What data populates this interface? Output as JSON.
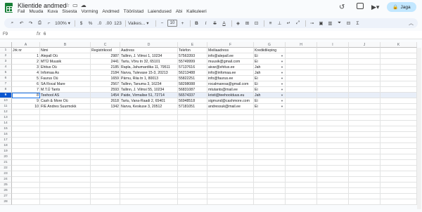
{
  "app": {
    "title": "Klientide andmed",
    "menu": [
      "Fail",
      "Muuda",
      "Kuva",
      "Sisesta",
      "Vorming",
      "Andmed",
      "Tööriistad",
      "Laiendused",
      "Abi",
      "Kalkuleeri"
    ],
    "share_label": "Jaga"
  },
  "toolbar": {
    "zoom": "100%",
    "currency": "$",
    "percent": "%",
    "dec_dec": ".0",
    "dec_inc": ".00",
    "format_123": "123",
    "font": "Vaikes...",
    "font_size": "10",
    "bold": "B",
    "italic": "I",
    "strike": "S",
    "text_color": "A"
  },
  "formula_bar": {
    "namebox": "F9",
    "fx": "fx",
    "value": "6"
  },
  "columns": [
    "A",
    "B",
    "C",
    "D",
    "E",
    "F",
    "G",
    "H",
    "I",
    "J",
    "K"
  ],
  "header_row": [
    "Jrk nr",
    "Nimi",
    "Registrikood",
    "Aadress",
    "Telefon",
    "Meiliaadress",
    "Krediidileping"
  ],
  "rows": [
    [
      "1",
      "Alepall Oü",
      "2987",
      "Tallinn, J. Vilmsi 1, 10234",
      "57563393",
      "info@alepall.ee",
      "Ei"
    ],
    [
      "2",
      "MTÜ Muusik",
      "2441",
      "Tartu, Võru tn 32, 65101",
      "55749999",
      "muusik@gmail.com",
      "Ei"
    ],
    [
      "3",
      "Ehitus Oü",
      "2185",
      "Rapla, Jahumardika 11, 79511",
      "57137616",
      "aivar@ehitus.ee",
      "Jah"
    ],
    [
      "4",
      "Infomaa As",
      "2184",
      "Narva, Tulevase 15-3, 20213",
      "56213488",
      "info@infomaa.ee",
      "Jah"
    ],
    [
      "5",
      "Faurus Oü",
      "1659",
      "Pärnu, Riia tn 1, 80013",
      "55822251",
      "info@faurus.ee",
      "Ei"
    ],
    [
      "6",
      "SA Rocal Mare",
      "2567",
      "Tallinn, Tanuma 3, 16234",
      "58298088",
      "rocalmaresa@gmail.com",
      "Ei"
    ],
    [
      "7",
      "M.T.Ü Tants",
      "2593",
      "Tallinn, J. Vilmsi 55, 10234",
      "56831087",
      "mtutants@mail.ee",
      "Ei"
    ],
    [
      "8",
      "Teehool AS",
      "1454",
      "Paide, Virmalise 51, 72714",
      "56574337",
      "kristi@teehoolduus.eu",
      "Jah"
    ],
    [
      "9",
      "Cash & More Oü",
      "2618",
      "Tartu, Vana-Raadi 2, 65401",
      "56948518",
      "sigmund@cashmore.com",
      "Ei"
    ],
    [
      "10",
      "FIE Andres Suurmokk",
      "1342",
      "Narva, Keskuse 3, 20512",
      "57181051",
      "andressuk@mail.ee",
      "Ei"
    ]
  ],
  "row_numbers": [
    "1",
    "2",
    "3",
    "4",
    "5",
    "6",
    "7",
    "8",
    "9",
    "10",
    "11",
    "12",
    "13",
    "14",
    "15",
    "16",
    "17",
    "18",
    "19",
    "20",
    "21",
    "22",
    "23",
    "24",
    "25",
    "26",
    "27",
    "28"
  ],
  "selected_row_number": "9"
}
